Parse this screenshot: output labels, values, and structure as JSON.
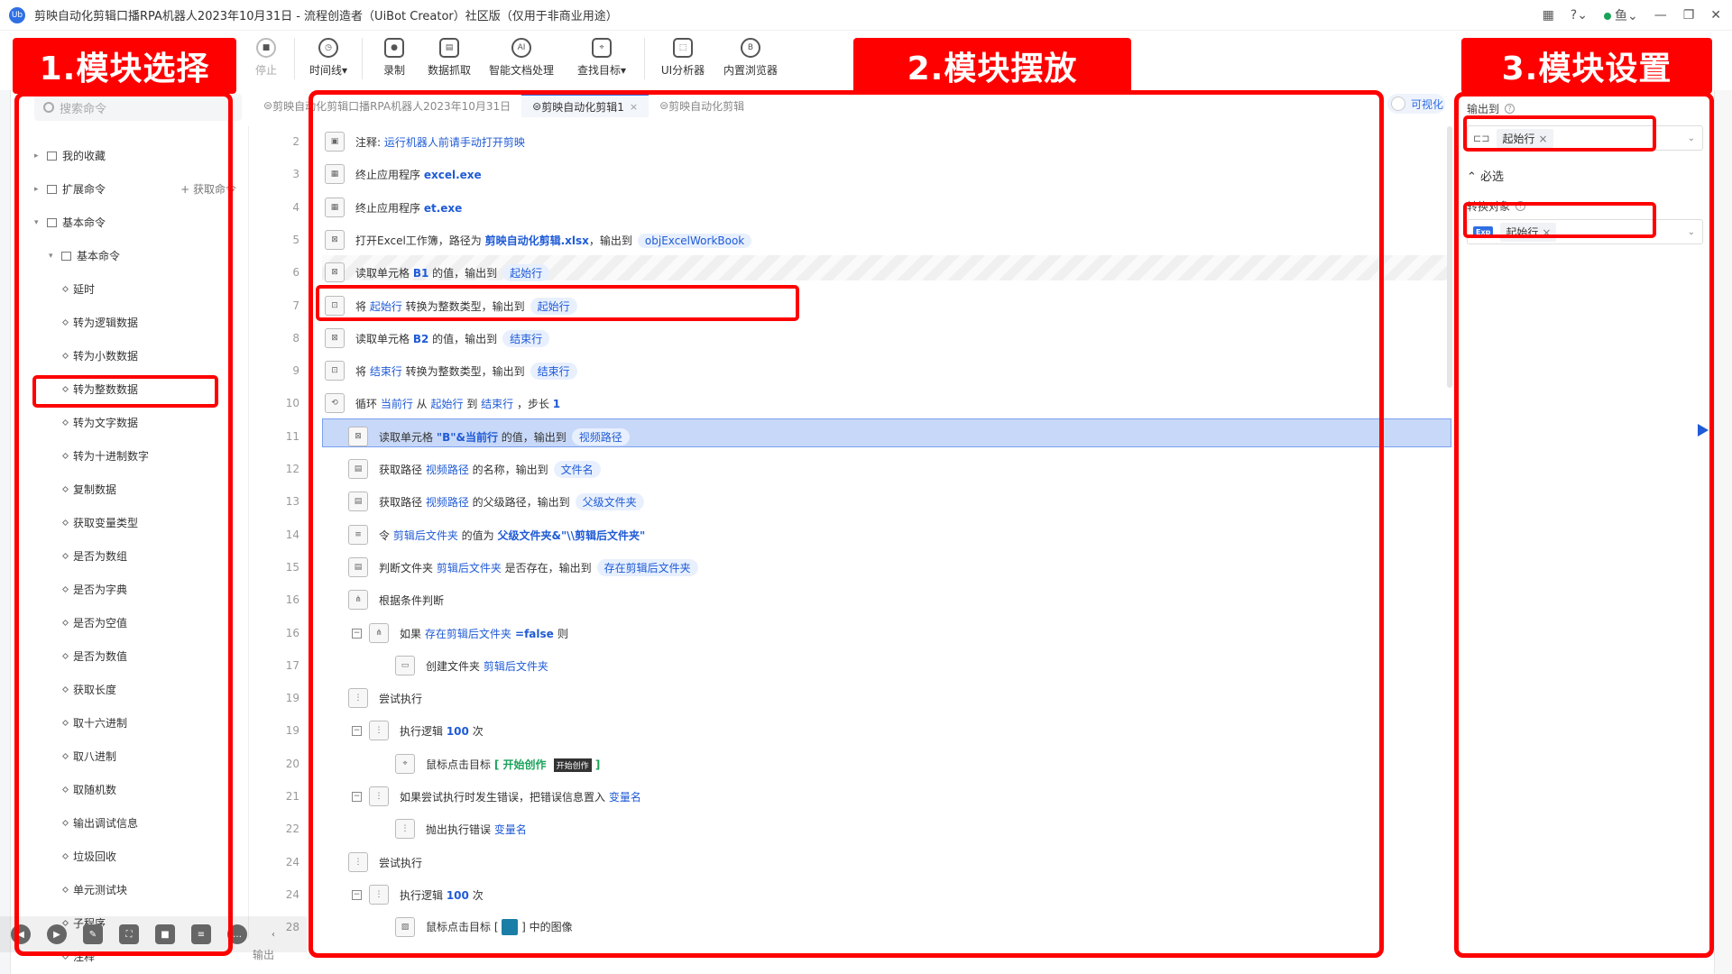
{
  "window": {
    "title": "剪映自动化剪辑口播RPA机器人2023年10月31日 - 流程创造者（UiBot Creator）社区版（仅用于非商业用途）",
    "logo": "Ub",
    "user": "鱼"
  },
  "toolbar": {
    "items": [
      {
        "label": "停止",
        "icon": "stop-icon"
      },
      {
        "label": "时间线",
        "icon": "clock-icon",
        "dropdown": true
      },
      {
        "label": "录制",
        "icon": "record-icon"
      },
      {
        "label": "数据抓取",
        "icon": "data-scrape-icon"
      },
      {
        "label": "智能文档处理",
        "icon": "ai-doc-icon"
      },
      {
        "label": "查找目标",
        "icon": "find-target-icon",
        "dropdown": true
      },
      {
        "label": "UI分析器",
        "icon": "ui-analyzer-icon"
      },
      {
        "label": "内置浏览器",
        "icon": "browser-icon"
      }
    ]
  },
  "sections": {
    "s1": "1.模块选择",
    "s2": "2.模块摆放",
    "s3": "3.模块设置"
  },
  "left": {
    "search_placeholder": "搜索命令",
    "fetch_label": "获取命令",
    "tree": [
      {
        "label": "我的收藏",
        "level": 0,
        "type": "folder"
      },
      {
        "label": "扩展命令",
        "level": 0,
        "type": "folder"
      },
      {
        "label": "基本命令",
        "level": 0,
        "type": "folder",
        "open": true
      },
      {
        "label": "基本命令",
        "level": 1,
        "type": "folder",
        "open": true
      },
      {
        "label": "延时",
        "level": 2,
        "type": "leaf"
      },
      {
        "label": "转为逻辑数据",
        "level": 2,
        "type": "leaf"
      },
      {
        "label": "转为小数数据",
        "level": 2,
        "type": "leaf"
      },
      {
        "label": "转为整数数据",
        "level": 2,
        "type": "leaf"
      },
      {
        "label": "转为文字数据",
        "level": 2,
        "type": "leaf"
      },
      {
        "label": "转为十进制数字",
        "level": 2,
        "type": "leaf"
      },
      {
        "label": "复制数据",
        "level": 2,
        "type": "leaf"
      },
      {
        "label": "获取变量类型",
        "level": 2,
        "type": "leaf"
      },
      {
        "label": "是否为数组",
        "level": 2,
        "type": "leaf"
      },
      {
        "label": "是否为字典",
        "level": 2,
        "type": "leaf"
      },
      {
        "label": "是否为空值",
        "level": 2,
        "type": "leaf"
      },
      {
        "label": "是否为数值",
        "level": 2,
        "type": "leaf"
      },
      {
        "label": "获取长度",
        "level": 2,
        "type": "leaf"
      },
      {
        "label": "取十六进制",
        "level": 2,
        "type": "leaf"
      },
      {
        "label": "取八进制",
        "level": 2,
        "type": "leaf"
      },
      {
        "label": "取随机数",
        "level": 2,
        "type": "leaf"
      },
      {
        "label": "输出调试信息",
        "level": 2,
        "type": "leaf"
      },
      {
        "label": "垃圾回收",
        "level": 2,
        "type": "leaf"
      },
      {
        "label": "单元测试块",
        "level": 2,
        "type": "leaf"
      },
      {
        "label": "子程序",
        "level": 2,
        "type": "leaf"
      },
      {
        "label": "注释",
        "level": 2,
        "type": "leaf"
      }
    ]
  },
  "tabs": [
    {
      "label": "剪映自动化剪辑口播RPA机器人2023年10月31日",
      "active": false
    },
    {
      "label": "剪映自动化剪辑1",
      "active": true,
      "close": "×"
    },
    {
      "label": "剪映自动化剪辑",
      "active": false
    }
  ],
  "viz_label": "可视化",
  "code_rows": [
    {
      "ln": "2",
      "indent": 0,
      "icon": "comment-icon",
      "parts": [
        [
          "注释: ",
          ""
        ],
        [
          "运行机器人前请手动打开剪映",
          "k"
        ]
      ]
    },
    {
      "ln": "3",
      "indent": 0,
      "icon": "app-icon",
      "parts": [
        [
          "终止应用程序 ",
          ""
        ],
        [
          "excel.exe",
          "kb"
        ]
      ]
    },
    {
      "ln": "4",
      "indent": 0,
      "icon": "app-icon",
      "parts": [
        [
          "终止应用程序 ",
          ""
        ],
        [
          "et.exe",
          "kb"
        ]
      ]
    },
    {
      "ln": "5",
      "indent": 0,
      "icon": "excel-icon",
      "parts": [
        [
          "打开Excel工作簿，路径为 ",
          ""
        ],
        [
          "剪映自动化剪辑.xlsx",
          "kb"
        ],
        [
          "，输出到",
          ""
        ],
        [
          "objExcelWorkBook",
          "tag"
        ]
      ]
    },
    {
      "ln": "6",
      "indent": 0,
      "icon": "excel-icon",
      "parts": [
        [
          "读取单元格 ",
          ""
        ],
        [
          "B1",
          "kb"
        ],
        [
          " 的值，输出到",
          ""
        ],
        [
          "起始行",
          "tag"
        ]
      ]
    },
    {
      "ln": "7",
      "indent": 0,
      "icon": "convert-icon",
      "parts": [
        [
          "将 ",
          ""
        ],
        [
          "起始行",
          "k"
        ],
        [
          " 转换为整数类型，输出到",
          ""
        ],
        [
          "起始行",
          "tag"
        ]
      ],
      "selected": true
    },
    {
      "ln": "8",
      "indent": 0,
      "icon": "excel-icon",
      "parts": [
        [
          "读取单元格 ",
          ""
        ],
        [
          "B2",
          "kb"
        ],
        [
          " 的值，输出到",
          ""
        ],
        [
          "结束行",
          "tag"
        ]
      ]
    },
    {
      "ln": "9",
      "indent": 0,
      "icon": "convert-icon",
      "parts": [
        [
          "将 ",
          ""
        ],
        [
          "结束行",
          "k"
        ],
        [
          " 转换为整数类型，输出到",
          ""
        ],
        [
          "结束行",
          "tag"
        ]
      ]
    },
    {
      "ln": "10",
      "indent": 0,
      "icon": "loop-icon",
      "parts": [
        [
          "循环 ",
          ""
        ],
        [
          "当前行",
          "k"
        ],
        [
          " 从 ",
          ""
        ],
        [
          "起始行",
          "k"
        ],
        [
          " 到 ",
          ""
        ],
        [
          "结束行",
          "k"
        ],
        [
          " ，步长 ",
          ""
        ],
        [
          "1",
          "kb"
        ]
      ]
    },
    {
      "ln": "11",
      "indent": 1,
      "icon": "excel-icon",
      "parts": [
        [
          "读取单元格 ",
          ""
        ],
        [
          "\"B\"&当前行",
          "kb"
        ],
        [
          " 的值，输出到",
          ""
        ],
        [
          "视频路径",
          "tag"
        ]
      ]
    },
    {
      "ln": "12",
      "indent": 1,
      "icon": "file-icon",
      "parts": [
        [
          "获取路径 ",
          ""
        ],
        [
          "视频路径",
          "k"
        ],
        [
          " 的名称，输出到",
          ""
        ],
        [
          "文件名",
          "tag"
        ]
      ]
    },
    {
      "ln": "13",
      "indent": 1,
      "icon": "file-icon",
      "parts": [
        [
          "获取路径 ",
          ""
        ],
        [
          "视频路径",
          "k"
        ],
        [
          " 的父级路径，输出到",
          ""
        ],
        [
          "父级文件夹",
          "tag"
        ]
      ]
    },
    {
      "ln": "14",
      "indent": 1,
      "icon": "assign-icon",
      "parts": [
        [
          "令 ",
          ""
        ],
        [
          "剪辑后文件夹",
          "k"
        ],
        [
          " 的值为 ",
          ""
        ],
        [
          "父级文件夹&\"\\\\剪辑后文件夹\"",
          "kb"
        ]
      ]
    },
    {
      "ln": "15",
      "indent": 1,
      "icon": "file-icon",
      "parts": [
        [
          "判断文件夹 ",
          ""
        ],
        [
          "剪辑后文件夹",
          "k"
        ],
        [
          " 是否存在，输出到",
          ""
        ],
        [
          "存在剪辑后文件夹",
          "tag"
        ]
      ]
    },
    {
      "ln": "16",
      "indent": 1,
      "icon": "branch-icon",
      "parts": [
        [
          "根据条件判断",
          ""
        ]
      ]
    },
    {
      "ln": "16",
      "indent": 2,
      "collapse": "−",
      "icon": "branch-icon",
      "parts": [
        [
          "如果 ",
          ""
        ],
        [
          "存在剪辑后文件夹",
          "k"
        ],
        [
          " =false ",
          "kb"
        ],
        [
          "则",
          ""
        ]
      ]
    },
    {
      "ln": "17",
      "indent": 3,
      "icon": "folder-icon",
      "parts": [
        [
          "创建文件夹 ",
          ""
        ],
        [
          "剪辑后文件夹",
          "k"
        ]
      ]
    },
    {
      "ln": "19",
      "indent": 1,
      "icon": "try-icon",
      "parts": [
        [
          "尝试执行",
          ""
        ]
      ]
    },
    {
      "ln": "19",
      "indent": 2,
      "collapse": "−",
      "icon": "try-icon",
      "parts": [
        [
          "执行逻辑 ",
          ""
        ],
        [
          "100",
          "kb"
        ],
        [
          " 次",
          ""
        ]
      ]
    },
    {
      "ln": "20",
      "indent": 3,
      "icon": "mouse-icon",
      "parts": [
        [
          "鼠标点击目标 ",
          ""
        ],
        [
          "[ 开始创作 ",
          "gk"
        ],
        [
          "开始创作",
          "badge"
        ],
        [
          " ]",
          "gk"
        ]
      ]
    },
    {
      "ln": "21",
      "indent": 2,
      "collapse": "−",
      "icon": "try-icon",
      "parts": [
        [
          "如果尝试执行时发生错误，把错误信息置入 ",
          ""
        ],
        [
          "变量名",
          "k"
        ]
      ]
    },
    {
      "ln": "22",
      "indent": 3,
      "icon": "try-icon",
      "parts": [
        [
          "抛出执行错误 ",
          ""
        ],
        [
          "变量名",
          "k"
        ]
      ]
    },
    {
      "ln": "24",
      "indent": 1,
      "icon": "try-icon",
      "parts": [
        [
          "尝试执行",
          ""
        ]
      ]
    },
    {
      "ln": "24",
      "indent": 2,
      "collapse": "−",
      "icon": "try-icon",
      "parts": [
        [
          "执行逻辑 ",
          ""
        ],
        [
          "100",
          "kb"
        ],
        [
          " 次",
          ""
        ]
      ]
    },
    {
      "ln": "28",
      "indent": 3,
      "icon": "image-icon",
      "parts": [
        [
          "鼠标点击目标 [ ",
          ""
        ],
        [
          "",
          "teal"
        ],
        [
          " ] 中的图像",
          ""
        ]
      ]
    }
  ],
  "right": {
    "output_label": "输出到",
    "output_value": "起始行",
    "required_label": "必选",
    "convert_label": "转换对象",
    "convert_value": "起始行",
    "exp_badge": "Exp",
    "remove": "×"
  },
  "bottom_label": "输出",
  "float_toolbar": [
    "back-icon",
    "play-icon",
    "pen-icon",
    "screenshot-icon",
    "camera-icon",
    "chat-icon",
    "more-icon",
    "collapse-icon"
  ]
}
